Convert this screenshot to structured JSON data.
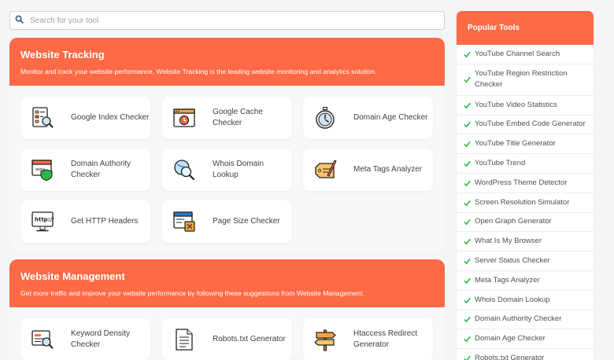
{
  "search": {
    "placeholder": "Search for your tool"
  },
  "sections": [
    {
      "title": "Website Tracking",
      "description": "Monitor and track your website performance. Website Tracking is the leading website monitoring and analytics solution.",
      "tools": [
        {
          "label": "Google Index Checker",
          "icon": "index-checker-icon"
        },
        {
          "label": "Google Cache Checker",
          "icon": "cache-checker-icon"
        },
        {
          "label": "Domain Age Checker",
          "icon": "stopwatch-icon"
        },
        {
          "label": "Domain Authority Checker",
          "icon": "browser-shield-icon"
        },
        {
          "label": "Whois Domain Lookup",
          "icon": "globe-magnifier-icon"
        },
        {
          "label": "Meta Tags Analyzer",
          "icon": "tag-pen-icon"
        },
        {
          "label": "Get HTTP Headers",
          "icon": "http-monitor-icon"
        },
        {
          "label": "Page Size Checker",
          "icon": "page-size-icon"
        }
      ]
    },
    {
      "title": "Website Management",
      "description": "Get more traffic and improve your website performance by following these suggestions from Website Management.",
      "tools": [
        {
          "label": "Keyword Density Checker",
          "icon": "keyword-density-icon"
        },
        {
          "label": "Robots.txt Generator",
          "icon": "document-icon"
        },
        {
          "label": "Htaccess Redirect Generator",
          "icon": "signpost-icon"
        }
      ]
    }
  ],
  "sidebar": {
    "title": "Popular Tools",
    "items": [
      "YouTube Channel Search",
      "YouTube Region Restriction Checker",
      "YouTube Video Statistics",
      "YouTube Embed Code Generator",
      "YouTube Title Generator",
      "YouTube Trend",
      "WordPress Theme Detector",
      "Screen Resolution Simulator",
      "Open Graph Generator",
      "What Is My Browser",
      "Server Status Checker",
      "Meta Tags Analyzer",
      "Whois Domain Lookup",
      "Domain Authority Checker",
      "Domain Age Checker",
      "Robots.txt Generator"
    ]
  },
  "colors": {
    "accent": "#fe6a45",
    "check": "#2db84d",
    "background": "#f4f5f7"
  }
}
